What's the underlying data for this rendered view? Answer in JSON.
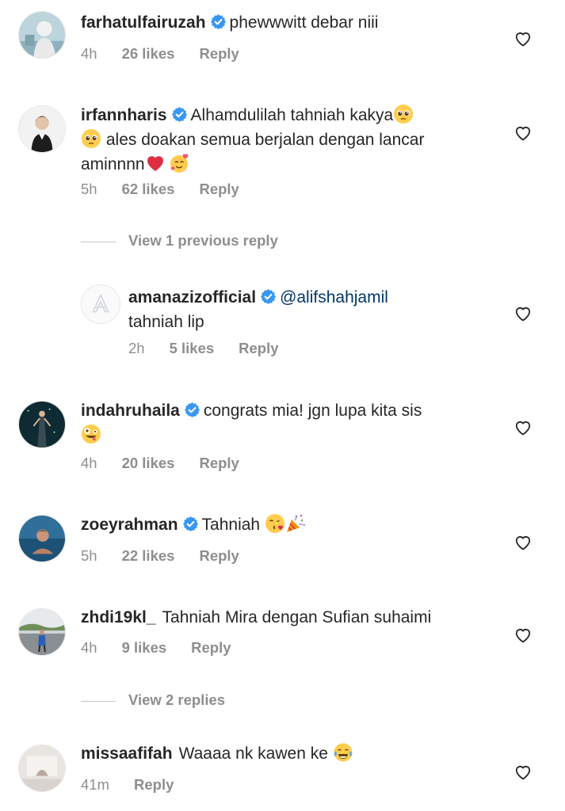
{
  "comments": [
    {
      "username": "farhatulfairuzah",
      "text": "phewwwitt debar niii",
      "time": "4h",
      "likes": "26 likes",
      "reply": "Reply"
    },
    {
      "username": "irfannharis",
      "text1": "Alhamdulilah tahniah kakya",
      "text2": "ales doakan semua berjalan dengan lancar",
      "text3": "aminnnn",
      "time": "5h",
      "likes": "62 likes",
      "reply": "Reply"
    },
    {
      "username": "amanazizofficial",
      "mention": "@alifshahjamil",
      "text": "tahniah lip",
      "time": "2h",
      "likes": "5 likes",
      "reply": "Reply"
    },
    {
      "username": "indahruhaila",
      "text": "congrats mia! jgn lupa kita sis",
      "time": "4h",
      "likes": "20 likes",
      "reply": "Reply"
    },
    {
      "username": "zoeyrahman",
      "text": "Tahniah",
      "time": "5h",
      "likes": "22 likes",
      "reply": "Reply"
    },
    {
      "username": "zhdi19kl_",
      "text": "Tahniah Mira dengan Sufian suhaimi",
      "time": "4h",
      "likes": "9 likes",
      "reply": "Reply"
    },
    {
      "username": "missaafifah",
      "text": "Waaaa nk kawen ke",
      "time": "41m",
      "reply": "Reply"
    }
  ],
  "view_previous_reply": "View 1 previous reply",
  "view_replies": "View 2 replies",
  "icons": {
    "verified": "verified-badge-icon",
    "like": "heart-outline-icon"
  },
  "colors": {
    "text": "#262626",
    "secondary": "#8e8e8e",
    "verified": "#3897f0",
    "mention": "#00376b"
  }
}
